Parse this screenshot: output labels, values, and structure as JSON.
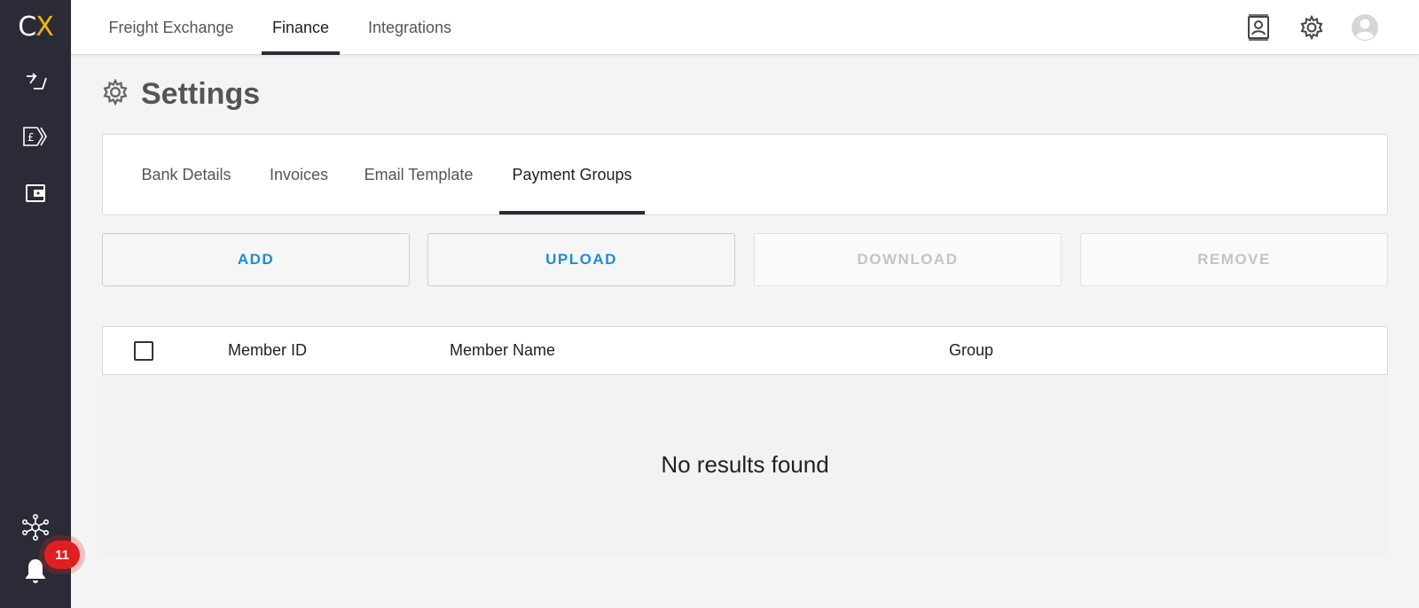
{
  "brand": {
    "logo_c": "C",
    "logo_x": "X",
    "accent": "#f2b705",
    "sidebar_bg": "#2a2b36"
  },
  "sidebar": {
    "items": [
      {
        "icon": "transfer-arrows-icon"
      },
      {
        "icon": "pound-tag-icon"
      },
      {
        "icon": "wallet-icon"
      }
    ],
    "network_icon": "network-hub-icon",
    "notifications": {
      "icon": "bell-icon",
      "count": "11"
    }
  },
  "topnav": {
    "items": [
      {
        "label": "Freight Exchange",
        "active": false
      },
      {
        "label": "Finance",
        "active": true
      },
      {
        "label": "Integrations",
        "active": false
      }
    ],
    "icons": [
      "contact-card-icon",
      "gear-icon",
      "user-avatar-icon"
    ]
  },
  "page": {
    "title": "Settings",
    "title_icon": "gear-icon"
  },
  "tabs": [
    {
      "label": "Bank Details",
      "active": false
    },
    {
      "label": "Invoices",
      "active": false
    },
    {
      "label": "Email Template",
      "active": false
    },
    {
      "label": "Payment Groups",
      "active": true
    }
  ],
  "actions": [
    {
      "label": "ADD",
      "enabled": true
    },
    {
      "label": "UPLOAD",
      "enabled": true
    },
    {
      "label": "DOWNLOAD",
      "enabled": false
    },
    {
      "label": "REMOVE",
      "enabled": false
    }
  ],
  "table": {
    "columns": [
      "Member ID",
      "Member Name",
      "Group"
    ],
    "empty_message": "No results found",
    "rows": []
  },
  "colors": {
    "link_blue": "#1a8fd6",
    "badge_red": "#e02020"
  }
}
